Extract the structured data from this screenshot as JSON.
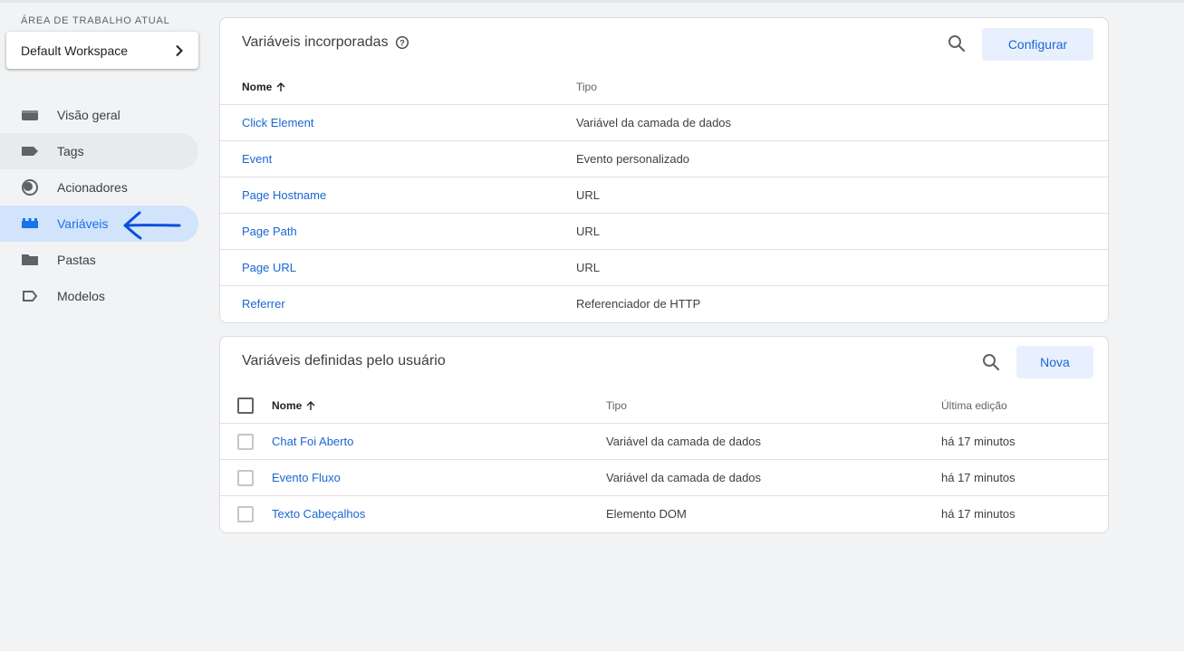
{
  "workspace": {
    "label": "ÁREA DE TRABALHO ATUAL",
    "name": "Default Workspace"
  },
  "nav": {
    "items": [
      {
        "label": "Visão geral",
        "icon": "overview-icon"
      },
      {
        "label": "Tags",
        "icon": "tag-icon"
      },
      {
        "label": "Acionadores",
        "icon": "trigger-icon"
      },
      {
        "label": "Variáveis",
        "icon": "variables-icon"
      },
      {
        "label": "Pastas",
        "icon": "folder-icon"
      },
      {
        "label": "Modelos",
        "icon": "template-icon"
      }
    ],
    "active_index": 3,
    "hover_index": 1
  },
  "builtin": {
    "title": "Variáveis incorporadas",
    "configure_label": "Configurar",
    "columns": {
      "name": "Nome",
      "type": "Tipo"
    },
    "rows": [
      {
        "name": "Click Element",
        "type": "Variável da camada de dados"
      },
      {
        "name": "Event",
        "type": "Evento personalizado"
      },
      {
        "name": "Page Hostname",
        "type": "URL"
      },
      {
        "name": "Page Path",
        "type": "URL"
      },
      {
        "name": "Page URL",
        "type": "URL"
      },
      {
        "name": "Referrer",
        "type": "Referenciador de HTTP"
      }
    ]
  },
  "user_defined": {
    "title": "Variáveis definidas pelo usuário",
    "new_label": "Nova",
    "columns": {
      "name": "Nome",
      "type": "Tipo",
      "edited": "Última edição"
    },
    "rows": [
      {
        "name": "Chat Foi Aberto",
        "type": "Variável da camada de dados",
        "edited": "há 17 minutos"
      },
      {
        "name": "Evento Fluxo",
        "type": "Variável da camada de dados",
        "edited": "há 17 minutos"
      },
      {
        "name": "Texto Cabeçalhos",
        "type": "Elemento DOM",
        "edited": "há 17 minutos"
      }
    ]
  },
  "colors": {
    "accent": "#1a73e8",
    "link": "#1967d2",
    "annotation": "#0b4fd9",
    "active_bg": "#d2e3fc",
    "button_bg": "#e8f0fe"
  }
}
